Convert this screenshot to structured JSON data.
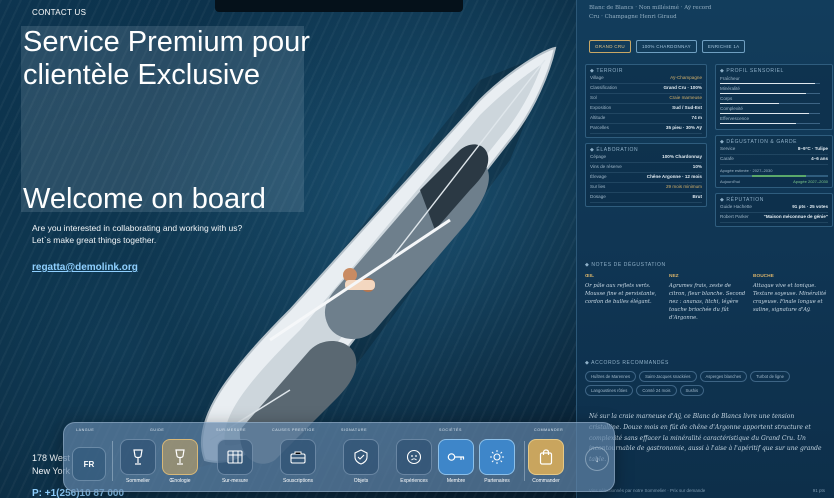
{
  "contact": {
    "title": "CONTACT US",
    "headline": "Service Premium pour clientèle Exclusive",
    "welcome": "Welcome on board",
    "intro_line1": "Are you interested in collaborating and working with us?",
    "intro_line2": "Let`s make great things together.",
    "email": "regatta@demolink.org",
    "address_line1": "178 West",
    "address_line2": "New York",
    "phone": "P: +1(256)10 87 000"
  },
  "panel": {
    "head_line1": "Blanc de Blancs · Non millésimé · Aÿ record",
    "head_line2": "Cru · Champagne Henri Giraud",
    "badges": [
      "GRAND CRU",
      "100% CHARDONNAY",
      "ENRICHIE 1A"
    ],
    "terroir": {
      "title": "◆ TERROIR",
      "rows": [
        {
          "k": "Village",
          "v": "Aÿ-Champagne",
          "gold": true
        },
        {
          "k": "Classification",
          "v": "Grand Cru · 100%",
          "gold": false
        },
        {
          "k": "Sol",
          "v": "Craie marneuse",
          "gold": true
        },
        {
          "k": "Exposition",
          "v": "Sud / Sud-Est",
          "gold": false
        },
        {
          "k": "Altitude",
          "v": "74 m",
          "gold": false
        },
        {
          "k": "Parcelles",
          "v": "35 pieu · 30% Aÿ",
          "gold": false
        }
      ]
    },
    "elaboration": {
      "title": "◆ ÉLABORATION",
      "rows": [
        {
          "k": "Cépage",
          "v": "100% Chardonnay",
          "gold": false
        },
        {
          "k": "Vins de réserve",
          "v": "10%",
          "gold": false
        },
        {
          "k": "Élevage",
          "v": "Chêne Argonne · 12 mois",
          "gold": false
        },
        {
          "k": "Sur lies",
          "v": "29 mois minimum",
          "gold": true
        },
        {
          "k": "Dosage",
          "v": "Brut",
          "gold": false
        }
      ]
    },
    "profil": {
      "title": "◆ PROFIL SENSORIEL",
      "bars": [
        {
          "label": "Fraîcheur",
          "value": 0.88
        },
        {
          "label": "Minéralité",
          "value": 0.8
        },
        {
          "label": "Corps",
          "value": 0.55
        },
        {
          "label": "Complexité",
          "value": 0.82
        },
        {
          "label": "Effervescence",
          "value": 0.7
        }
      ]
    },
    "degustation": {
      "title": "◆ DÉGUSTATION & GARDE",
      "rows": [
        {
          "k": "Service",
          "v": "8–9°C · Tulipe",
          "gold": false
        },
        {
          "k": "Carafe",
          "v": "4–6 ans",
          "gold": false
        }
      ],
      "aging_label": "Apogée estimée · 2027–2030",
      "aging_left": "Aujourd'hui",
      "aging_right": "Apogée 2027–2030"
    },
    "reputation": {
      "title": "◆ RÉPUTATION",
      "rows": [
        {
          "k": "Guide Hachette",
          "v": "91 pts · 25 votes",
          "gold": false
        },
        {
          "k": "Robert Parker",
          "v": "\"Maison méconnue de génie\"",
          "gold": false
        }
      ]
    },
    "notes": {
      "title": "◆ NOTES DE DÉGUSTATION",
      "oeil_t": "ŒIL",
      "oeil_b": "Or pâle aux reflets verts. Mousse fine et persistante, cordon de bulles élégant.",
      "nez_t": "NEZ",
      "nez_b": "Agrumes frais, zeste de citron, fleur blanche. Second nez : ananas, litchi, légère touche briochée du fût d'Argonne.",
      "bouche_t": "BOUCHE",
      "bouche_b": "Attaque vive et tonique. Texture soyeuse. Minéralité crayeuse. Finale longue et saline, signature d'Aÿ."
    },
    "pairings": {
      "title": "◆ ACCORDS RECOMMANDÉS",
      "chips": [
        "Huîtres de Marennes",
        "Saint-Jacques snackées",
        "Asperges blanches",
        "Turbot de ligne",
        "Langoustines rôties",
        "Comté 24 mois",
        "Sushis"
      ]
    },
    "story": "Né sur la craie marneuse d'Aÿ, ce Blanc de Blancs livre une tension cristalline. Douze mois en fût de chêne d'Argonne apportent structure et complexité sans effacer la minéralité caractéristique du Grand Cru. Un incontournable de gastronomie, aussi à l'aise à l'apéritif que sur une grande table.",
    "foot_left": "Vins sélectionnés par notre Sommelier · Prix sur demande",
    "foot_right": "91 pts"
  },
  "dock": {
    "lang_label": "LANGUE",
    "lang": "FR",
    "groups": {
      "guide": "GUIDE",
      "surmesure": "SUR-MESURE",
      "causes": "CAUSES PRESTIGE",
      "signature": "SIGNATURE",
      "societes": "SOCIÉTÉS",
      "commander": "COMMANDER"
    },
    "items": {
      "sommelier": "Sommelier",
      "oenologie": "Œnologie",
      "surmesure": "Sur-mesure",
      "souscriptions": "Souscriptions",
      "objets": "Objets",
      "experiences": "Expériences",
      "membre": "Membre",
      "partenaires": "Partenaires",
      "commander": "Commander"
    },
    "colors": {
      "accent_gold": "#c9a55e",
      "accent_blue": "#3e86c9"
    }
  }
}
